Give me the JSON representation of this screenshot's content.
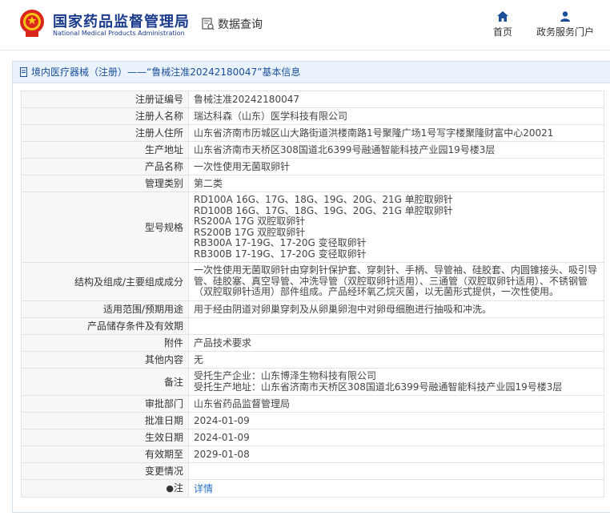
{
  "header": {
    "title_cn": "国家药品监督管理局",
    "title_en": "National Medical Products Administration",
    "query_label": "数据查询",
    "nav": {
      "home": "首页",
      "gov": "政务服务门户"
    }
  },
  "panel": {
    "title": "境内医疗器械（注册）——“鲁械注准20242180047”基本信息"
  },
  "rows": {
    "reg_no": {
      "label": "注册证编号",
      "value": "鲁械注准20242180047"
    },
    "registrant": {
      "label": "注册人名称",
      "value": "瑞达科森（山东）医学科技有限公司"
    },
    "registrant_addr": {
      "label": "注册人住所",
      "value": "山东省济南市历城区山大路街道洪楼南路1号聚隆广场1号写字楼聚隆财富中心20021"
    },
    "prod_addr": {
      "label": "生产地址",
      "value": "山东省济南市天桥区308国道北6399号融通智能科技产业园19号楼3层"
    },
    "product_name": {
      "label": "产品名称",
      "value": "一次性使用无菌取卵针"
    },
    "category": {
      "label": "管理类别",
      "value": "第二类"
    },
    "models": {
      "label": "型号规格",
      "values": [
        "RD100A 16G、17G、18G、19G、20G、21G 单腔取卵针",
        "RD100B 16G、17G、18G、19G、20G、21G 单腔取卵针",
        "RS200A 17G 双腔取卵针",
        "RS200B 17G 双腔取卵针",
        "RB300A 17-19G、17-20G 变径取卵针",
        "RB300B 17-19G、17-20G 变径取卵针"
      ]
    },
    "structure": {
      "label": "结构及组成/主要组成成分",
      "values": [
        "一次性使用无菌取卵针由穿刺针保护套、穿刺针、手柄、导管袖、硅胶套、内圆锥接头、吸引导",
        "管、硅胶塞、真空导管、冲洗导管（双腔取卵针适用）、三通管（双腔取卵针适用）、不锈钢管",
        "（双腔取卵针适用）部件组成。产品经环氧乙烷灭菌，以无菌形式提供，一次性使用。"
      ]
    },
    "scope": {
      "label": "适用范围/预期用途",
      "value": "用于经由阴道对卵巢穿刺及从卵巢卵泡中对卵母细胞进行抽吸和冲洗。"
    },
    "storage": {
      "label": "产品储存条件及有效期",
      "value": ""
    },
    "attachment": {
      "label": "附件",
      "value": "产品技术要求"
    },
    "other": {
      "label": "其他内容",
      "value": "无"
    },
    "remark": {
      "label": "备注",
      "values": [
        "受托生产企业：山东博泽生物科技有限公司",
        "受托生产地址：山东省济南市天桥区308国道北6399号融通智能科技产业园19号楼3层"
      ]
    },
    "dept": {
      "label": "审批部门",
      "value": "山东省药品监督管理局"
    },
    "approve_date": {
      "label": "批准日期",
      "value": "2024-01-09"
    },
    "effective_date": {
      "label": "生效日期",
      "value": "2024-01-09"
    },
    "expire_date": {
      "label": "有效期至",
      "value": "2029-01-08"
    },
    "change": {
      "label": "变更情况",
      "value": ""
    },
    "note": {
      "label": "注",
      "value": "详情"
    }
  },
  "icons": {
    "emblem": "national-emblem-icon",
    "query": "data-query-icon",
    "home": "home-icon",
    "user": "user-icon",
    "title": "document-icon",
    "pin": "pin-icon"
  },
  "colors": {
    "brand": "#1a3a8c",
    "link": "#2a6fc9",
    "panel_bg": "#eaf2fb"
  }
}
